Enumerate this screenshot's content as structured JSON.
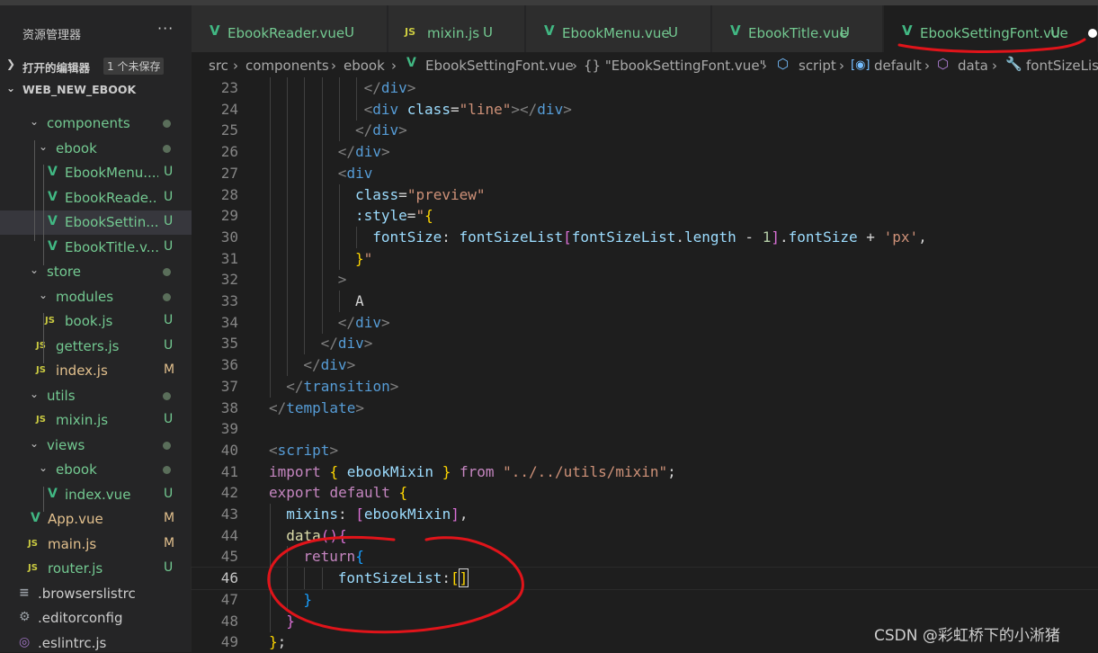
{
  "sidebar": {
    "title": "资源管理器",
    "more": "···",
    "open_editors": {
      "label": "打开的编辑器",
      "badge": "1 个未保存"
    },
    "project": {
      "label": "WEB_NEW_EBOOK"
    },
    "tree": [
      {
        "label": "components",
        "type": "folder",
        "depth": 1,
        "status": "dot"
      },
      {
        "label": "ebook",
        "type": "folder",
        "depth": 2,
        "status": "dot"
      },
      {
        "label": "EbookMenu....",
        "type": "vue",
        "depth": 3,
        "status": "U"
      },
      {
        "label": "EbookReade...",
        "type": "vue",
        "depth": 3,
        "status": "U"
      },
      {
        "label": "EbookSettin...",
        "type": "vue",
        "depth": 3,
        "status": "U",
        "selected": true
      },
      {
        "label": "EbookTitle.v...",
        "type": "vue",
        "depth": 3,
        "status": "U"
      },
      {
        "label": "store",
        "type": "folder",
        "depth": 1,
        "status": "dot"
      },
      {
        "label": "modules",
        "type": "folder",
        "depth": 2,
        "status": "dot"
      },
      {
        "label": "book.js",
        "type": "js",
        "depth": 3,
        "status": "U"
      },
      {
        "label": "getters.js",
        "type": "js",
        "depth": 2,
        "status": "U"
      },
      {
        "label": "index.js",
        "type": "js",
        "depth": 2,
        "status": "M"
      },
      {
        "label": "utils",
        "type": "folder",
        "depth": 1,
        "status": "dot"
      },
      {
        "label": "mixin.js",
        "type": "js",
        "depth": 2,
        "status": "U"
      },
      {
        "label": "views",
        "type": "folder",
        "depth": 1,
        "status": "dot"
      },
      {
        "label": "ebook",
        "type": "folder",
        "depth": 2,
        "status": "dot"
      },
      {
        "label": "index.vue",
        "type": "vue",
        "depth": 3,
        "status": "U"
      },
      {
        "label": "App.vue",
        "type": "vue",
        "depth": 1,
        "status": "M"
      },
      {
        "label": "main.js",
        "type": "js",
        "depth": 1,
        "status": "M"
      },
      {
        "label": "router.js",
        "type": "js",
        "depth": 1,
        "status": "U"
      },
      {
        "label": ".browserslistrc",
        "type": "list",
        "depth": 0,
        "status": ""
      },
      {
        "label": ".editorconfig",
        "type": "gear",
        "depth": 0,
        "status": ""
      },
      {
        "label": ".eslintrc.js",
        "type": "eslint",
        "depth": 0,
        "status": ""
      }
    ]
  },
  "tabs": [
    {
      "label": "EbookReader.vue",
      "type": "vue",
      "status": "U"
    },
    {
      "label": "mixin.js",
      "type": "js",
      "status": "U"
    },
    {
      "label": "EbookMenu.vue",
      "type": "vue",
      "status": "U"
    },
    {
      "label": "EbookTitle.vue",
      "type": "vue",
      "status": "U"
    },
    {
      "label": "EbookSettingFont.vue",
      "type": "vue",
      "status": "U",
      "active": true,
      "unsaved": true
    }
  ],
  "breadcrumb": {
    "src": "src",
    "components": "components",
    "ebook": "ebook",
    "file": "EbookSettingFont.vue",
    "object": "{} \"EbookSettingFont.vue\"",
    "script": "script",
    "default": "default",
    "data": "data",
    "member": "fontSizeList"
  },
  "editor": {
    "current_line": 46,
    "lines": [
      {
        "n": 23,
        "indent": 11,
        "tokens": [
          [
            "</",
            "punct"
          ],
          [
            "div",
            "tag"
          ],
          [
            ">",
            "punct"
          ]
        ]
      },
      {
        "n": 24,
        "indent": 11,
        "tokens": [
          [
            "<",
            "punct"
          ],
          [
            "div",
            "tag"
          ],
          [
            " ",
            "plain"
          ],
          [
            "class",
            "attr"
          ],
          [
            "=",
            "plain"
          ],
          [
            "\"line\"",
            "str"
          ],
          [
            "></",
            "punct"
          ],
          [
            "div",
            "tag"
          ],
          [
            ">",
            "punct"
          ]
        ]
      },
      {
        "n": 25,
        "indent": 10,
        "tokens": [
          [
            "</",
            "punct"
          ],
          [
            "div",
            "tag"
          ],
          [
            ">",
            "punct"
          ]
        ]
      },
      {
        "n": 26,
        "indent": 8,
        "tokens": [
          [
            "</",
            "punct"
          ],
          [
            "div",
            "tag"
          ],
          [
            ">",
            "punct"
          ]
        ]
      },
      {
        "n": 27,
        "indent": 8,
        "tokens": [
          [
            "<",
            "punct"
          ],
          [
            "div",
            "tag"
          ]
        ]
      },
      {
        "n": 28,
        "indent": 10,
        "tokens": [
          [
            "class",
            "attr"
          ],
          [
            "=",
            "plain"
          ],
          [
            "\"preview\"",
            "str"
          ]
        ]
      },
      {
        "n": 29,
        "indent": 10,
        "tokens": [
          [
            ":style",
            "attr"
          ],
          [
            "=",
            "plain"
          ],
          [
            "\"",
            "str"
          ],
          [
            "{",
            "br1"
          ]
        ]
      },
      {
        "n": 30,
        "indent": 12,
        "tokens": [
          [
            "fontSize",
            "prop"
          ],
          [
            ": ",
            "plain"
          ],
          [
            "fontSizeList",
            "var"
          ],
          [
            "[",
            "br2"
          ],
          [
            "fontSizeList",
            "var"
          ],
          [
            ".",
            "plain"
          ],
          [
            "length",
            "prop"
          ],
          [
            " - ",
            "plain"
          ],
          [
            "1",
            "num"
          ],
          [
            "]",
            "br2"
          ],
          [
            ".",
            "plain"
          ],
          [
            "fontSize",
            "prop"
          ],
          [
            " + ",
            "plain"
          ],
          [
            "'px'",
            "str"
          ],
          [
            ",",
            "plain"
          ]
        ]
      },
      {
        "n": 31,
        "indent": 10,
        "tokens": [
          [
            "}",
            "br1"
          ],
          [
            "\"",
            "str"
          ]
        ]
      },
      {
        "n": 32,
        "indent": 8,
        "tokens": [
          [
            ">",
            "punct"
          ]
        ]
      },
      {
        "n": 33,
        "indent": 10,
        "tokens": [
          [
            "A",
            "plain"
          ]
        ]
      },
      {
        "n": 34,
        "indent": 8,
        "tokens": [
          [
            "</",
            "punct"
          ],
          [
            "div",
            "tag"
          ],
          [
            ">",
            "punct"
          ]
        ]
      },
      {
        "n": 35,
        "indent": 6,
        "tokens": [
          [
            "</",
            "punct"
          ],
          [
            "div",
            "tag"
          ],
          [
            ">",
            "punct"
          ]
        ]
      },
      {
        "n": 36,
        "indent": 4,
        "tokens": [
          [
            "</",
            "punct"
          ],
          [
            "div",
            "tag"
          ],
          [
            ">",
            "punct"
          ]
        ]
      },
      {
        "n": 37,
        "indent": 2,
        "tokens": [
          [
            "</",
            "punct"
          ],
          [
            "transition",
            "tag"
          ],
          [
            ">",
            "punct"
          ]
        ]
      },
      {
        "n": 38,
        "indent": 0,
        "tokens": [
          [
            "</",
            "punct"
          ],
          [
            "template",
            "tag"
          ],
          [
            ">",
            "punct"
          ]
        ]
      },
      {
        "n": 39,
        "indent": 0,
        "tokens": []
      },
      {
        "n": 40,
        "indent": 0,
        "tokens": [
          [
            "<",
            "punct"
          ],
          [
            "script",
            "tag"
          ],
          [
            ">",
            "punct"
          ]
        ]
      },
      {
        "n": 41,
        "indent": 0,
        "tokens": [
          [
            "import",
            "kw"
          ],
          [
            " ",
            "plain"
          ],
          [
            "{",
            "br1"
          ],
          [
            " ",
            "plain"
          ],
          [
            "ebookMixin",
            "var"
          ],
          [
            " ",
            "plain"
          ],
          [
            "}",
            "br1"
          ],
          [
            " ",
            "plain"
          ],
          [
            "from",
            "kw"
          ],
          [
            " ",
            "plain"
          ],
          [
            "\"../../utils/mixin\"",
            "str"
          ],
          [
            ";",
            "plain"
          ]
        ]
      },
      {
        "n": 42,
        "indent": 0,
        "tokens": [
          [
            "export",
            "kw"
          ],
          [
            " ",
            "plain"
          ],
          [
            "default",
            "kw"
          ],
          [
            " ",
            "plain"
          ],
          [
            "{",
            "br1"
          ]
        ]
      },
      {
        "n": 43,
        "indent": 2,
        "tokens": [
          [
            "mixins",
            "prop"
          ],
          [
            ": ",
            "plain"
          ],
          [
            "[",
            "br2"
          ],
          [
            "ebookMixin",
            "var"
          ],
          [
            "]",
            "br2"
          ],
          [
            ",",
            "plain"
          ]
        ]
      },
      {
        "n": 44,
        "indent": 2,
        "tokens": [
          [
            "data",
            "fn"
          ],
          [
            "()",
            "br2"
          ],
          [
            "{",
            "br2"
          ]
        ]
      },
      {
        "n": 45,
        "indent": 4,
        "tokens": [
          [
            "return",
            "kw"
          ],
          [
            "{",
            "br3"
          ]
        ]
      },
      {
        "n": 46,
        "indent": 8,
        "tokens": [
          [
            "fontSizeList",
            "prop"
          ],
          [
            ":",
            "plain"
          ],
          [
            "[",
            "br1"
          ],
          [
            "]",
            "br1cursor"
          ]
        ]
      },
      {
        "n": 47,
        "indent": 4,
        "tokens": [
          [
            "}",
            "br3"
          ]
        ]
      },
      {
        "n": 48,
        "indent": 2,
        "tokens": [
          [
            "}",
            "br2"
          ]
        ]
      },
      {
        "n": 49,
        "indent": 0,
        "tokens": [
          [
            "}",
            "br1"
          ],
          [
            ";",
            "plain"
          ]
        ]
      }
    ]
  },
  "watermark": "CSDN @彩虹桥下的小淅猪",
  "colors": {
    "annotation": "#e0141a",
    "vue_green": "#41b883",
    "untracked": "#73c991",
    "modified": "#e2c08d"
  }
}
